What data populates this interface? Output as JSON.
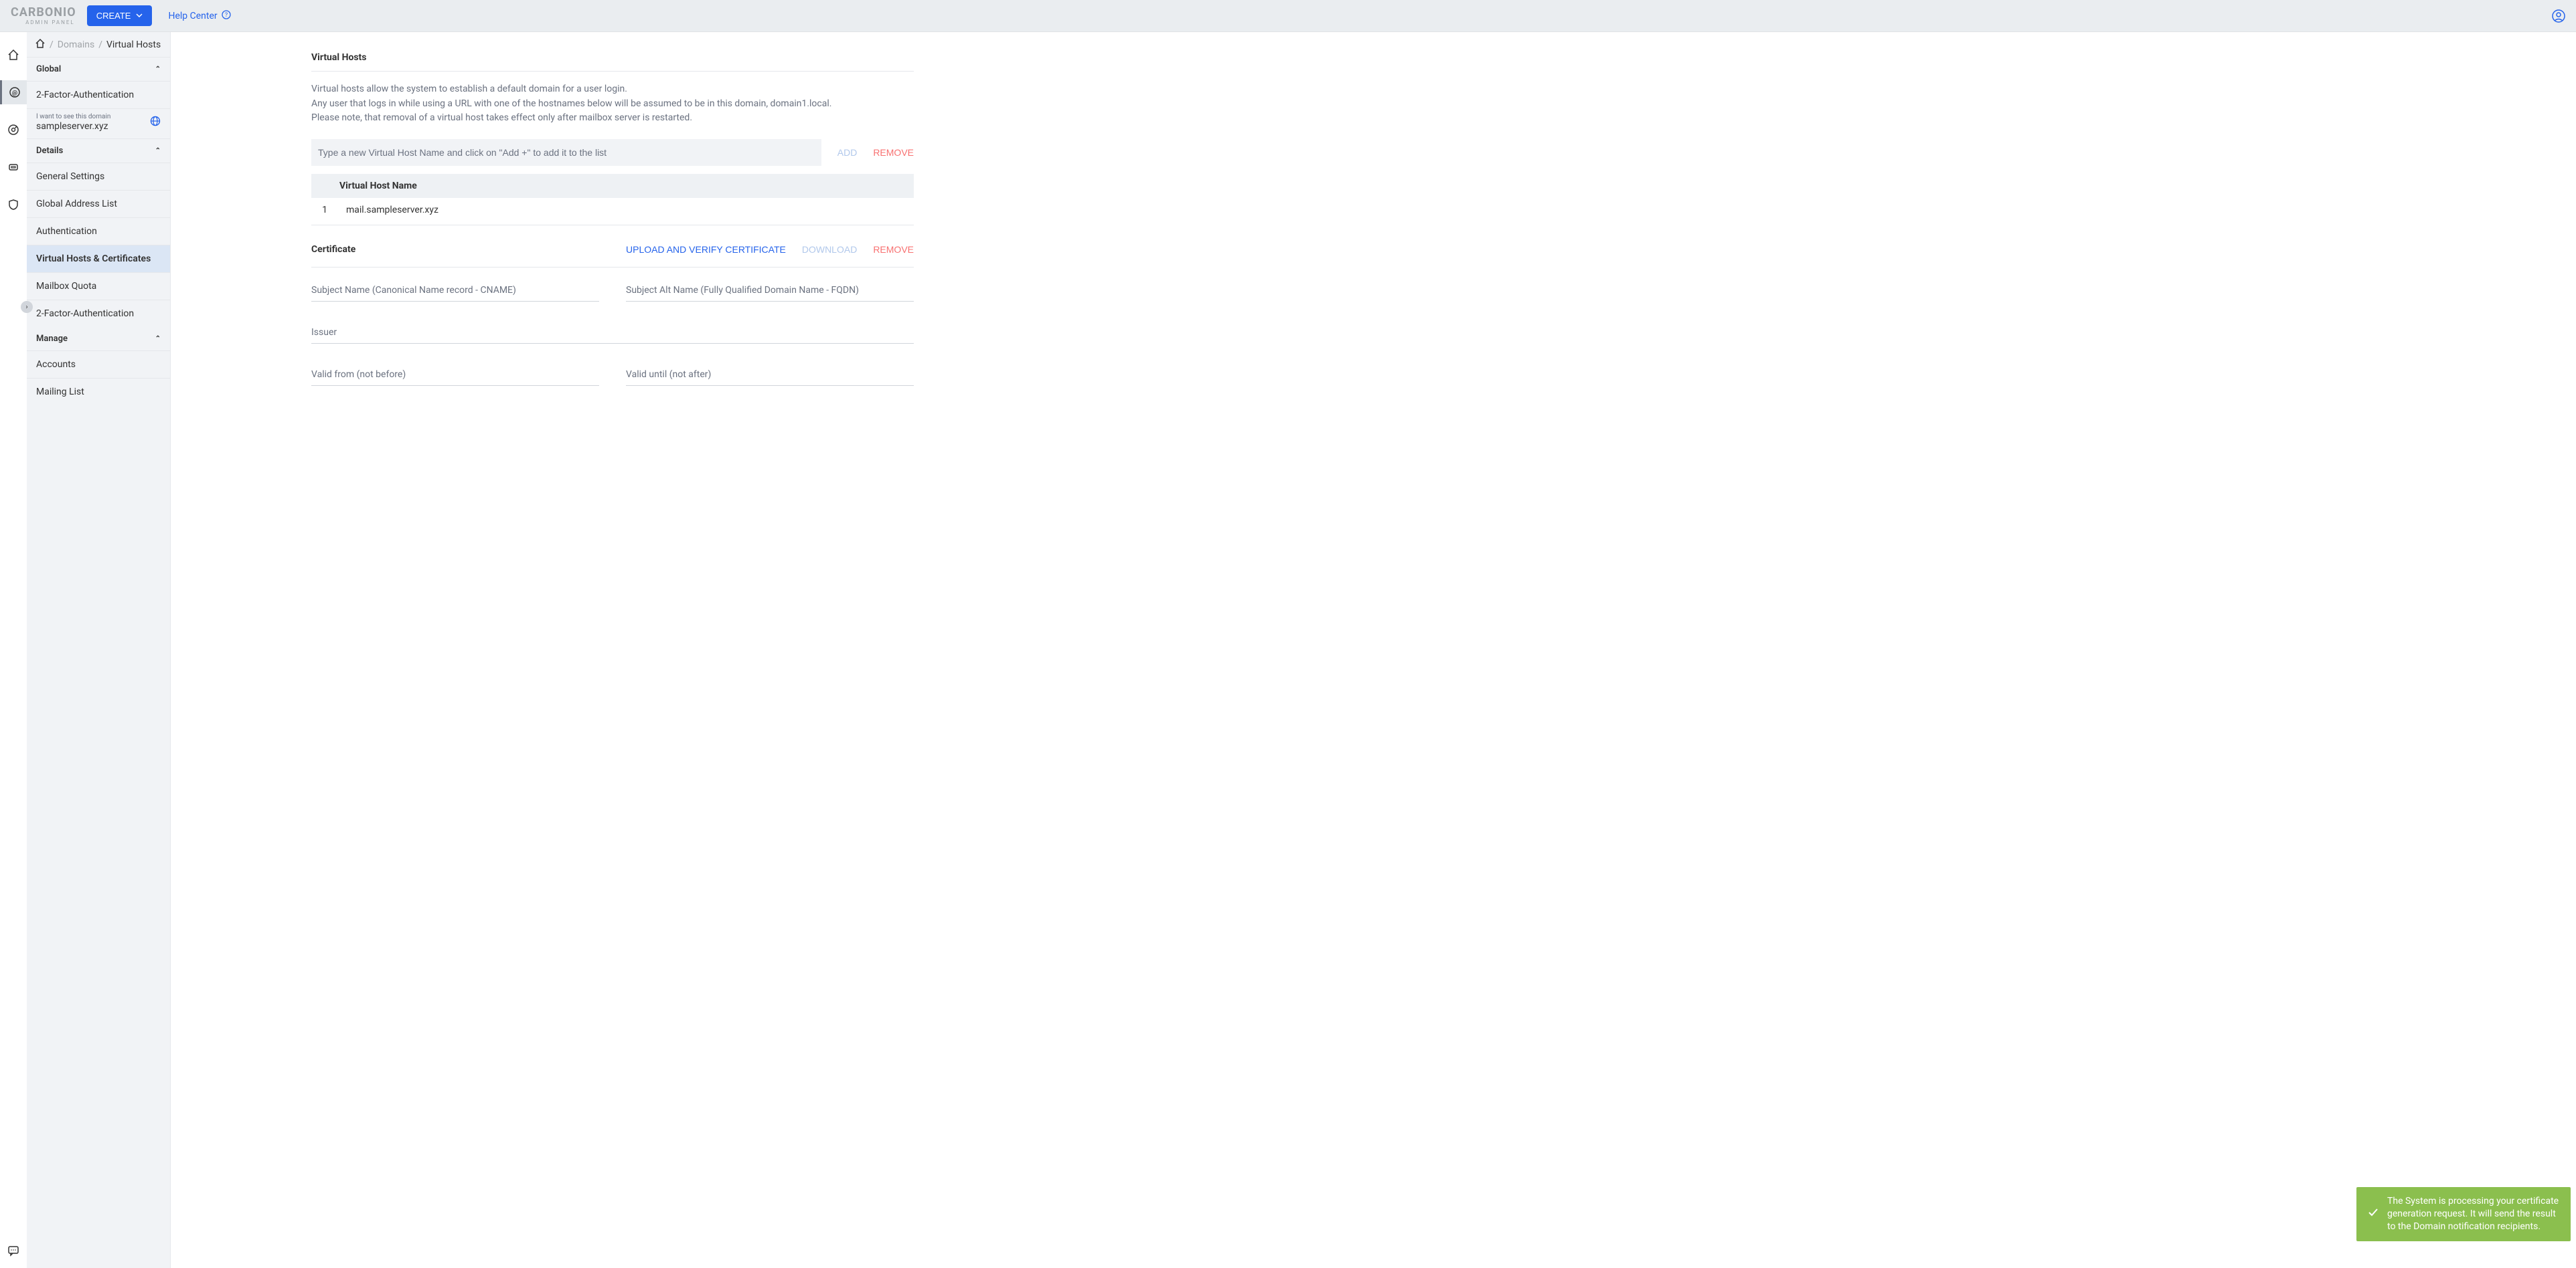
{
  "header": {
    "logo_main": "CARBONIO",
    "logo_sub": "ADMIN PANEL",
    "create_label": "CREATE",
    "help_center_label": "Help Center"
  },
  "breadcrumb": {
    "section": "Domains",
    "current": "Virtual Hosts"
  },
  "sidebar": {
    "global_header": "Global",
    "global_items": [
      "2-Factor-Authentication"
    ],
    "domain_label": "I want to see this domain",
    "domain_value": "sampleserver.xyz",
    "details_header": "Details",
    "details_items": [
      "General Settings",
      "Global Address List",
      "Authentication",
      "Virtual Hosts & Certificates",
      "Mailbox Quota",
      "2-Factor-Authentication"
    ],
    "details_selected_index": 3,
    "manage_header": "Manage",
    "manage_items": [
      "Accounts",
      "Mailing List"
    ]
  },
  "virtual_hosts": {
    "title": "Virtual Hosts",
    "desc_line1": "Virtual hosts allow the system to establish a default domain for a user login.",
    "desc_line2": "Any user that logs in while using a URL with one of the hostnames below will be assumed to be in this domain, domain1.local.",
    "desc_line3": "Please note, that removal of a virtual host takes effect only after mailbox server is restarted.",
    "input_placeholder": "Type a new Virtual Host Name and click on \"Add +\" to add it to the list",
    "add_label": "ADD",
    "remove_label": "REMOVE",
    "table_header": "Virtual Host Name",
    "rows": [
      {
        "idx": "1",
        "name": "mail.sampleserver.xyz"
      }
    ]
  },
  "certificate": {
    "title": "Certificate",
    "upload_label": "UPLOAD AND VERIFY CERTIFICATE",
    "download_label": "DOWNLOAD",
    "remove_label": "REMOVE",
    "subject_name_label": "Subject Name (Canonical Name record - CNAME)",
    "subject_alt_label": "Subject Alt Name (Fully Qualified Domain Name - FQDN)",
    "issuer_label": "Issuer",
    "valid_from_label": "Valid from (not before)",
    "valid_until_label": "Valid until (not after)"
  },
  "toast": {
    "message": "The System is processing your certificate generation request. It will send the result to the Domain notification recipients."
  }
}
